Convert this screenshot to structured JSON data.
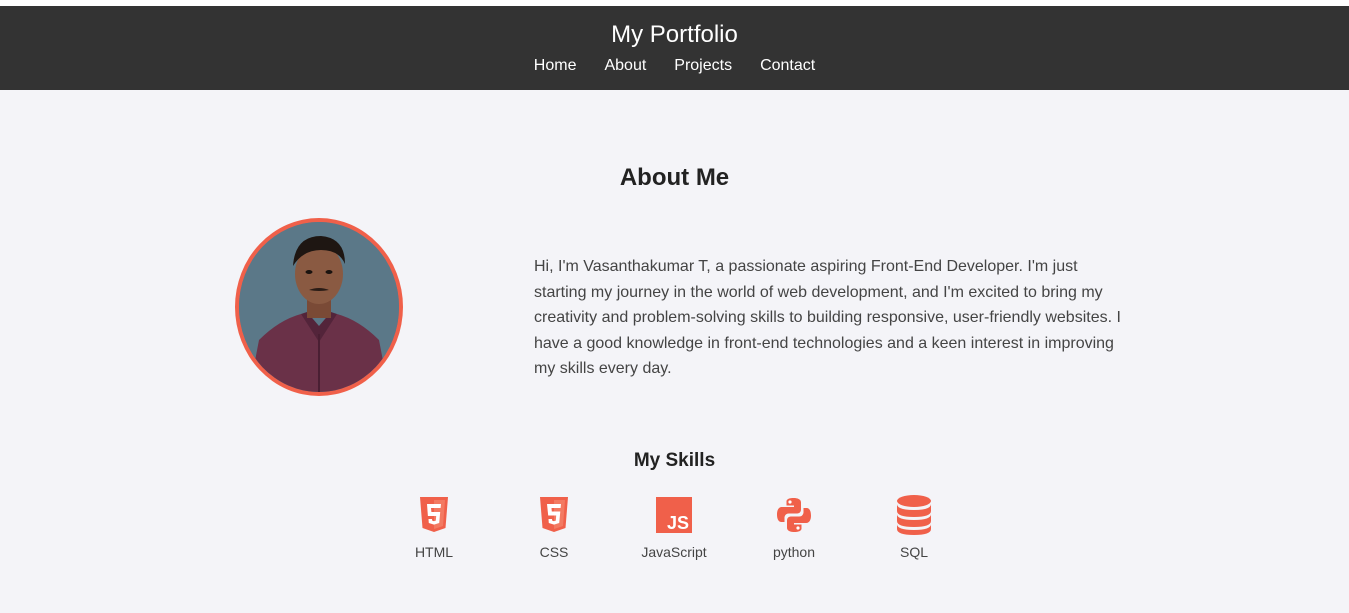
{
  "header": {
    "title": "My Portfolio",
    "nav": [
      "Home",
      "About",
      "Projects",
      "Contact"
    ]
  },
  "about": {
    "heading": "About Me",
    "bio": "Hi, I'm Vasanthakumar T, a passionate aspiring Front-End Developer. I'm just starting my journey in the world of web development, and I'm excited to bring my creativity and problem-solving skills to building responsive, user-friendly websites. I have a good knowledge in front-end technologies and a keen interest in improving my skills every day."
  },
  "skills": {
    "heading": "My Skills",
    "items": [
      {
        "label": "HTML",
        "icon": "html5-icon"
      },
      {
        "label": "CSS",
        "icon": "css3-icon"
      },
      {
        "label": "JavaScript",
        "icon": "js-icon"
      },
      {
        "label": "python",
        "icon": "python-icon"
      },
      {
        "label": "SQL",
        "icon": "database-icon"
      }
    ]
  },
  "colors": {
    "header_bg": "#333333",
    "accent": "#f0604a",
    "page_bg": "#f4f4f8"
  }
}
